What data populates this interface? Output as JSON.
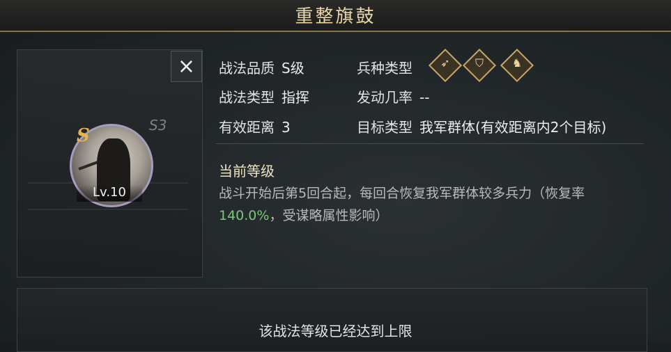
{
  "title": "重整旗鼓",
  "skill": {
    "grade_letter": "S",
    "season": "S3",
    "level": "Lv.10"
  },
  "close_icon": "×",
  "info": {
    "quality_label": "战法品质",
    "quality_value": "S级",
    "troop_label": "兵种类型",
    "troop_icons": [
      "archer-icon",
      "shield-icon",
      "cavalry-icon"
    ],
    "type_label": "战法类型",
    "type_value": "指挥",
    "rate_label": "发动几率",
    "rate_value": "--",
    "range_label": "有效距离",
    "range_value": "3",
    "target_label": "目标类型",
    "target_value": "我军群体(有效距离内2个目标)"
  },
  "current_level_title": "当前等级",
  "description": {
    "part1": "战斗开始后第5回合起，每回合恢复我军群体较多兵力（恢复率",
    "highlight": "140.0%",
    "part2": "，受谋略属性影响）"
  },
  "max_level_text": "该战法等级已经达到上限",
  "colors": {
    "accent_gold": "#c9a969",
    "highlight_green": "#7ec77a",
    "grade_gold": "#e7b54b"
  }
}
